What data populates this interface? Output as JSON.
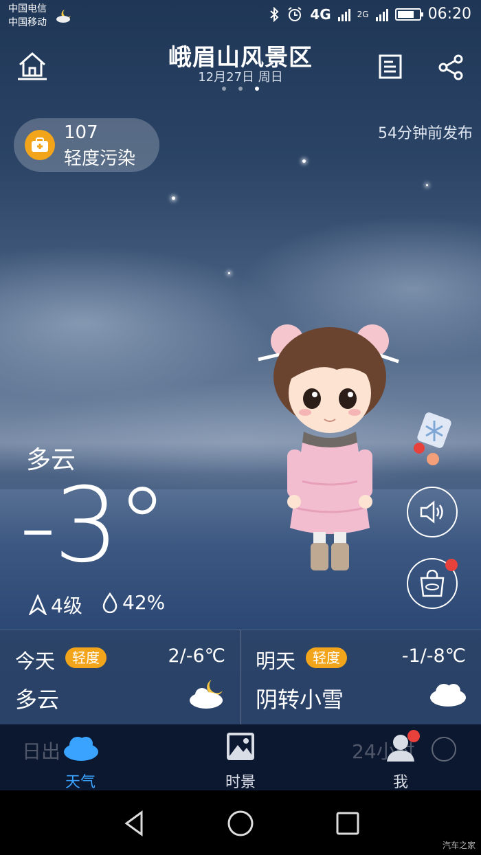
{
  "status_bar": {
    "carrier_1": "中国电信",
    "carrier_2": "中国移动",
    "network": "4G",
    "network_2": "2G",
    "time": "06:20"
  },
  "header": {
    "city": "峨眉山风景区",
    "date": "12月27日 周日",
    "page_count": 3,
    "active_page": 3
  },
  "aqi": {
    "value": "107",
    "label": "轻度污染",
    "color": "#f2a51a"
  },
  "published": "54分钟前发布",
  "current": {
    "condition": "多云",
    "temperature": "-3°",
    "wind": "4级",
    "humidity": "42%"
  },
  "forecast": [
    {
      "day": "今天",
      "aqi_badge": "轻度",
      "range": "2/-6℃",
      "condition": "多云",
      "icon": "partly-cloudy-night-icon"
    },
    {
      "day": "明天",
      "aqi_badge": "轻度",
      "range": "-1/-8℃",
      "condition": "阴转小雪",
      "icon": "cloud-icon"
    }
  ],
  "bottom_ghost": {
    "left": "日出 00",
    "right": "24小时"
  },
  "tabs": {
    "weather": "天气",
    "scene": "时景",
    "me": "我",
    "active_color": "#3aa3ff"
  },
  "watermark": "汽车之家"
}
